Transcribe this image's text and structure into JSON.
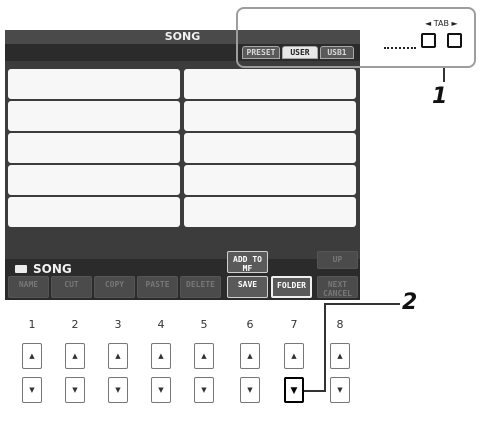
{
  "screen": {
    "title": "SONG",
    "tabs": [
      {
        "label": "PRESET",
        "active": false
      },
      {
        "label": "USER",
        "active": true
      },
      {
        "label": "USB1",
        "active": false
      }
    ],
    "folder": {
      "name": "SONG"
    },
    "page": "P1",
    "function_buttons": {
      "add_to_mf": "ADD TO MF",
      "up": "UP",
      "name": "NAME",
      "cut": "CUT",
      "copy": "COPY",
      "paste": "PASTE",
      "delete": "DELETE",
      "save": "SAVE",
      "folder": "FOLDER",
      "next_cancel": "NEXT CANCEL"
    }
  },
  "panel": {
    "tab_label": "TAB",
    "callout_1": "1",
    "callout_2": "2",
    "button_numbers": [
      "1",
      "2",
      "3",
      "4",
      "5",
      "6",
      "7",
      "8"
    ]
  }
}
